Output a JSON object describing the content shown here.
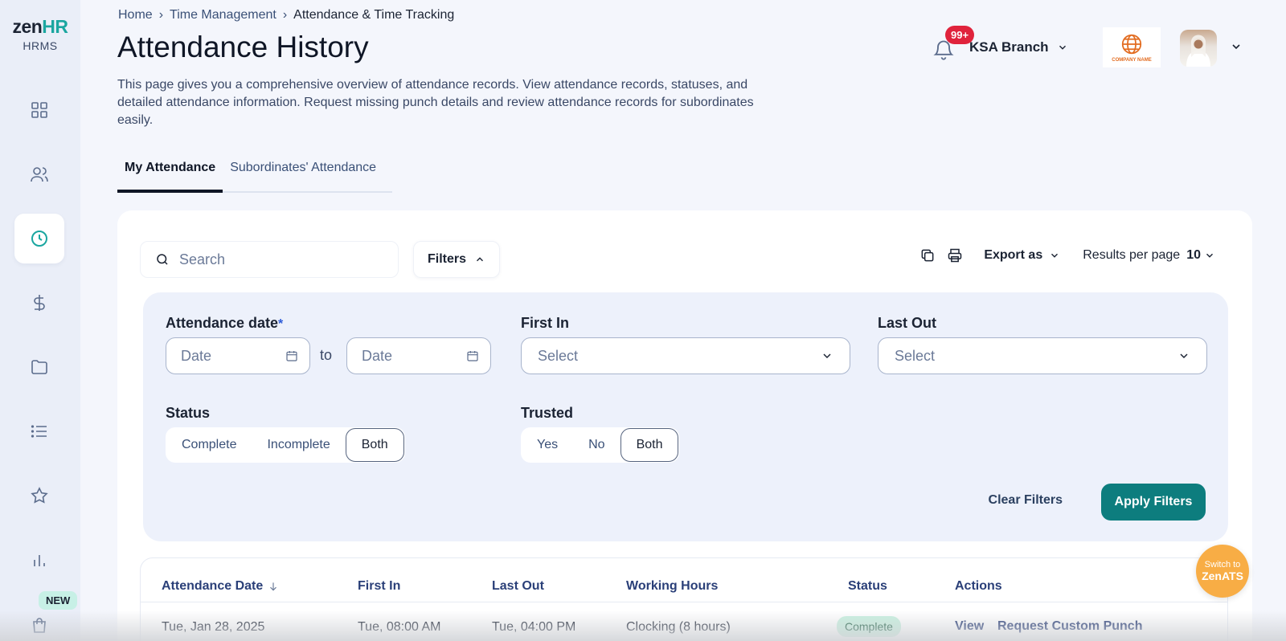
{
  "sidebar": {
    "logo_main": "zen",
    "logo_accent": "HR",
    "logo_sub": "HRMS",
    "items": [
      {
        "icon": "dashboard-icon"
      },
      {
        "icon": "users-icon"
      },
      {
        "icon": "clock-icon",
        "active": true
      },
      {
        "icon": "dollar-icon"
      },
      {
        "icon": "folder-icon"
      },
      {
        "icon": "list-icon"
      },
      {
        "icon": "star-icon"
      },
      {
        "icon": "bar-chart-icon"
      },
      {
        "icon": "shopping-bag-icon"
      }
    ],
    "new_badge": "NEW"
  },
  "header": {
    "breadcrumb": [
      "Home",
      "Time Management",
      "Attendance & Time Tracking"
    ],
    "title": "Attendance History",
    "description": "This page gives you a comprehensive overview of attendance records. View attendance records, statuses, and detailed attendance information. Request missing punch details and review attendance records for subordinates easily.",
    "notification_count": "99+",
    "branch": "KSA Branch",
    "company_logo_text": "COMPANY NAME"
  },
  "tabs": [
    {
      "label": "My Attendance",
      "active": true
    },
    {
      "label": "Subordinates' Attendance",
      "active": false
    }
  ],
  "toolbar": {
    "search_placeholder": "Search",
    "filters_label": "Filters",
    "export_label": "Export as",
    "results_per_page_label": "Results per page",
    "results_per_page_value": "10"
  },
  "filters": {
    "attendance_date_label": "Attendance date",
    "required_mark": "*",
    "date_from_placeholder": "Date",
    "to_label": "to",
    "date_to_placeholder": "Date",
    "first_in_label": "First In",
    "first_in_value": "Select",
    "last_out_label": "Last Out",
    "last_out_value": "Select",
    "status_label": "Status",
    "status_options": [
      "Complete",
      "Incomplete",
      "Both"
    ],
    "status_selected": "Both",
    "trusted_label": "Trusted",
    "trusted_options": [
      "Yes",
      "No",
      "Both"
    ],
    "trusted_selected": "Both",
    "clear_label": "Clear Filters",
    "apply_label": "Apply Filters"
  },
  "table": {
    "columns": [
      "Attendance Date",
      "First In",
      "Last Out",
      "Working Hours",
      "Status",
      "Actions"
    ],
    "rows": [
      {
        "date": "Tue, Jan 28, 2025",
        "first_in": "Tue, 08:00 AM",
        "last_out": "Tue, 04:00 PM",
        "working_hours": "Clocking (8 hours)",
        "status": "Complete",
        "actions": [
          "View",
          "Request Custom Punch"
        ]
      }
    ]
  },
  "switch_ats": {
    "line1": "Switch to",
    "line2": "ZenATS"
  },
  "colors": {
    "accent": "#0d7d7e",
    "brand_hr": "#1aa6a0",
    "badge_red": "#e0233c",
    "status_complete_bg": "#c8f0df",
    "ats_orange": "#f8ad45"
  }
}
